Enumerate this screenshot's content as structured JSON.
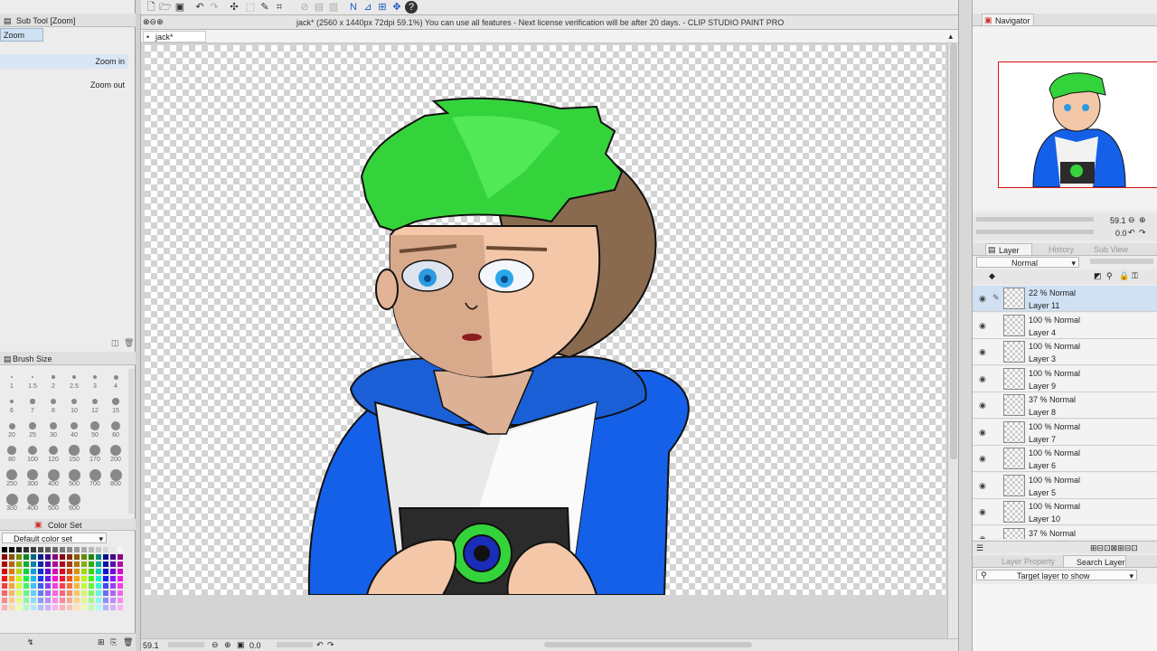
{
  "window_title": "jack* (2560 x 1440px 72dpi 59.1%)  You can use all features - Next license verification will be after 20 days. - CLIP STUDIO PAINT PRO",
  "document_tab": "jack*",
  "sub_tool": {
    "header": "Sub Tool [Zoom]",
    "tab": "Zoom",
    "items": [
      "Zoom in",
      "Zoom out"
    ]
  },
  "brush_size": {
    "header": "Brush Size",
    "rows": [
      [
        "1",
        "1.5",
        "2",
        "2.5",
        "3",
        "4"
      ],
      [
        "6",
        "7",
        "8",
        "10",
        "12",
        "15"
      ],
      [
        "20",
        "25",
        "30",
        "40",
        "50",
        "60"
      ],
      [
        "80",
        "100",
        "120",
        "150",
        "170",
        "200"
      ],
      [
        "250",
        "300",
        "400",
        "500",
        "700",
        "800"
      ],
      [
        "300",
        "400",
        "500",
        "600"
      ]
    ]
  },
  "color_set": {
    "tab": "Color Set",
    "selected": "Default color set"
  },
  "navigator": {
    "tab": "Navigator",
    "zoom": "59.1",
    "rotation": "0.0"
  },
  "layer_panel": {
    "tabs": [
      "Layer",
      "History",
      "Sub View"
    ],
    "blend_mode": "Normal",
    "layers": [
      {
        "opacity": "22 % Normal",
        "name": "Layer 11",
        "selected": true
      },
      {
        "opacity": "100 % Normal",
        "name": "Layer 4",
        "selected": false
      },
      {
        "opacity": "100 % Normal",
        "name": "Layer 3",
        "selected": false
      },
      {
        "opacity": "100 % Normal",
        "name": "Layer 9",
        "selected": false
      },
      {
        "opacity": "37 % Normal",
        "name": "Layer 8",
        "selected": false
      },
      {
        "opacity": "100 % Normal",
        "name": "Layer 7",
        "selected": false
      },
      {
        "opacity": "100 % Normal",
        "name": "Layer 6",
        "selected": false
      },
      {
        "opacity": "100 % Normal",
        "name": "Layer 5",
        "selected": false
      },
      {
        "opacity": "100 % Normal",
        "name": "Layer 10",
        "selected": false
      },
      {
        "opacity": "37 % Normal",
        "name": "",
        "selected": false
      }
    ]
  },
  "layer_property": {
    "tabs": [
      "Layer Property",
      "Search Layer"
    ],
    "target": "Target layer to show"
  },
  "status": {
    "zoom": "59.1",
    "rotation": "0.0"
  },
  "colors": {
    "hair": "#35d33b",
    "hoodie": "#1560e8",
    "skin": "#f3c7a8"
  }
}
